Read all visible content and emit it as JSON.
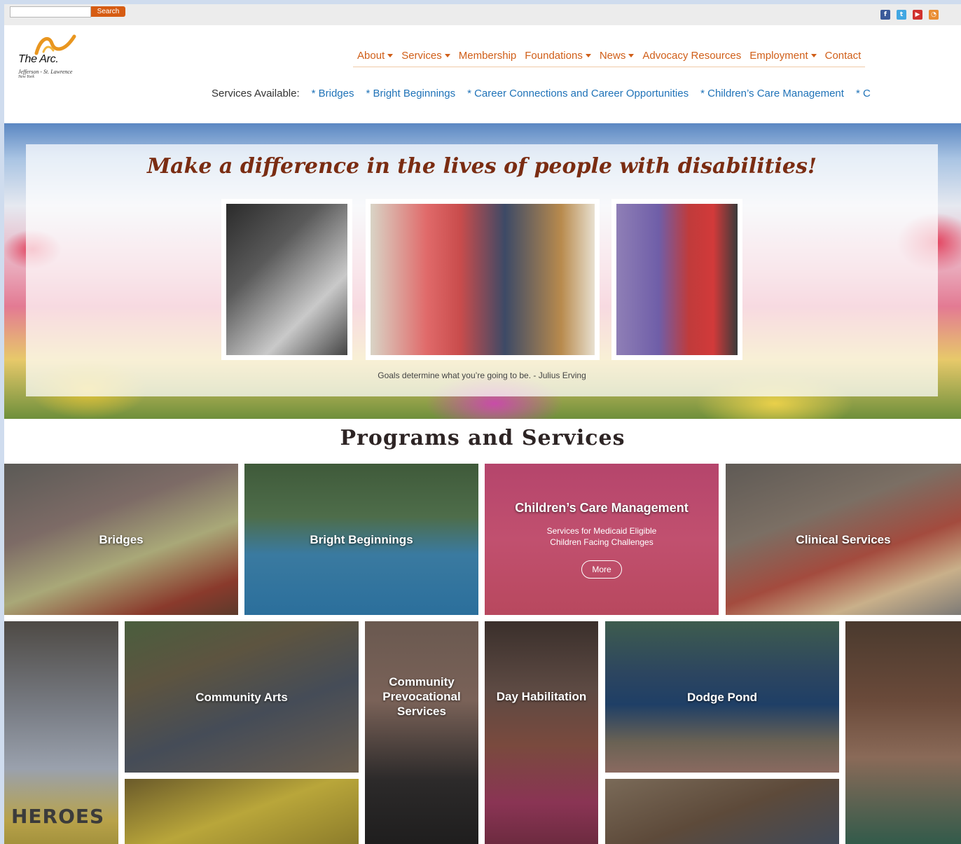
{
  "topbar": {
    "search_placeholder": "",
    "search_button": "Search",
    "social": [
      {
        "name": "facebook",
        "glyph": "f"
      },
      {
        "name": "twitter",
        "glyph": "t"
      },
      {
        "name": "youtube",
        "glyph": "▶"
      },
      {
        "name": "rss",
        "glyph": "◔"
      }
    ]
  },
  "logo": {
    "name": "The Arc.",
    "sub": "Jefferson - St. Lawrence",
    "sub2": "New York"
  },
  "nav": {
    "items": [
      {
        "label": "About",
        "dropdown": true
      },
      {
        "label": "Services",
        "dropdown": true
      },
      {
        "label": "Membership",
        "dropdown": false
      },
      {
        "label": "Foundations",
        "dropdown": true
      },
      {
        "label": "News",
        "dropdown": true
      },
      {
        "label": "Advocacy Resources",
        "dropdown": false
      },
      {
        "label": "Employment",
        "dropdown": true
      },
      {
        "label": "Contact",
        "dropdown": false
      }
    ]
  },
  "services_bar": {
    "label": "Services Available:",
    "links": [
      "* Bridges",
      "* Bright Beginnings",
      "* Career Connections and Career Opportunities",
      "* Children’s Care Management",
      "* C"
    ]
  },
  "hero": {
    "title": "Make a difference in the lives of people with disabilities!",
    "quote": "Goals determine what you’re going to be. - Julius Erving"
  },
  "programs": {
    "title": "Programs and Services",
    "tiles": [
      {
        "label": "Bridges"
      },
      {
        "label": "Bright Beginnings"
      },
      {
        "label": "Children’s Care Management",
        "sub": "Services for Medicaid Eligible Children Facing Challenges",
        "more": "More"
      },
      {
        "label": "Clinical Services"
      },
      {
        "label": ""
      },
      {
        "label": "Community Arts"
      },
      {
        "label": "Community Prevocational Services"
      },
      {
        "label": "Day Habilitation"
      },
      {
        "label": "Dodge Pond"
      },
      {
        "label": ""
      },
      {
        "label": ""
      },
      {
        "label": ""
      }
    ],
    "heroes_text": "HEROES"
  },
  "colors": {
    "accent": "#d05e18",
    "link": "#2073b8",
    "hero_title": "#7a2c12"
  }
}
